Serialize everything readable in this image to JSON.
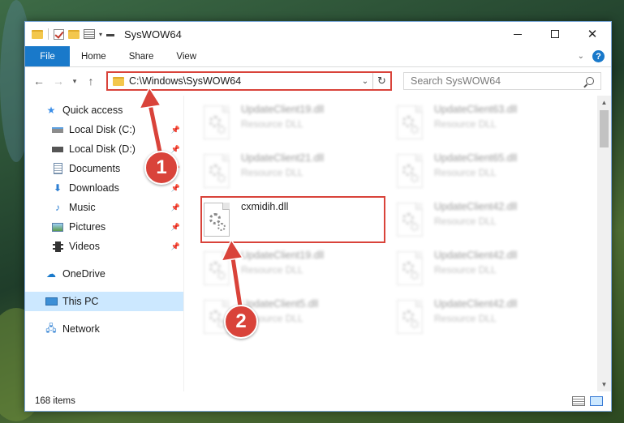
{
  "window": {
    "title": "SysWOW64",
    "accent_color": "#1979ca",
    "highlight_color": "#d9433a"
  },
  "ribbon": {
    "tabs": [
      {
        "label": "File"
      },
      {
        "label": "Home"
      },
      {
        "label": "Share"
      },
      {
        "label": "View"
      }
    ],
    "help": "?"
  },
  "navbar": {
    "address": "C:\\Windows\\SysWOW64",
    "search_placeholder": "Search SysWOW64"
  },
  "sidebar": {
    "quick_access": {
      "label": "Quick access",
      "icon": "star-icon"
    },
    "items": [
      {
        "label": "Local Disk (C:)",
        "icon": "drive-icon"
      },
      {
        "label": "Local Disk (D:)",
        "icon": "drive-icon"
      },
      {
        "label": "Documents",
        "icon": "document-icon"
      },
      {
        "label": "Downloads",
        "icon": "download-icon"
      },
      {
        "label": "Music",
        "icon": "music-icon"
      },
      {
        "label": "Pictures",
        "icon": "pictures-icon"
      },
      {
        "label": "Videos",
        "icon": "video-icon"
      }
    ],
    "onedrive": {
      "label": "OneDrive",
      "icon": "cloud-icon"
    },
    "this_pc": {
      "label": "This PC",
      "icon": "computer-icon"
    },
    "network": {
      "label": "Network",
      "icon": "network-icon"
    }
  },
  "files": {
    "left": [
      {
        "name": "UpdateClient19.dll",
        "desc": "Resource DLL"
      },
      {
        "name": "UpdateClient21.dll",
        "desc": "Resource DLL"
      },
      {
        "name": "cxmidih.dll",
        "desc": ""
      },
      {
        "name": "UpdateClient19.dll",
        "desc": "Resource DLL"
      },
      {
        "name": "UpdateClient5.dll",
        "desc": "Resource DLL"
      }
    ],
    "right": [
      {
        "name": "UpdateClient63.dll",
        "desc": "Resource DLL"
      },
      {
        "name": "UpdateClient65.dll",
        "desc": "Resource DLL"
      },
      {
        "name": "UpdateClient42.dll",
        "desc": "Resource DLL"
      },
      {
        "name": "UpdateClient42.dll",
        "desc": "Resource DLL"
      },
      {
        "name": "UpdateClient42.dll",
        "desc": "Resource DLL"
      }
    ]
  },
  "status": {
    "count": "168 items"
  },
  "annotations": {
    "step1": "1",
    "step2": "2"
  }
}
